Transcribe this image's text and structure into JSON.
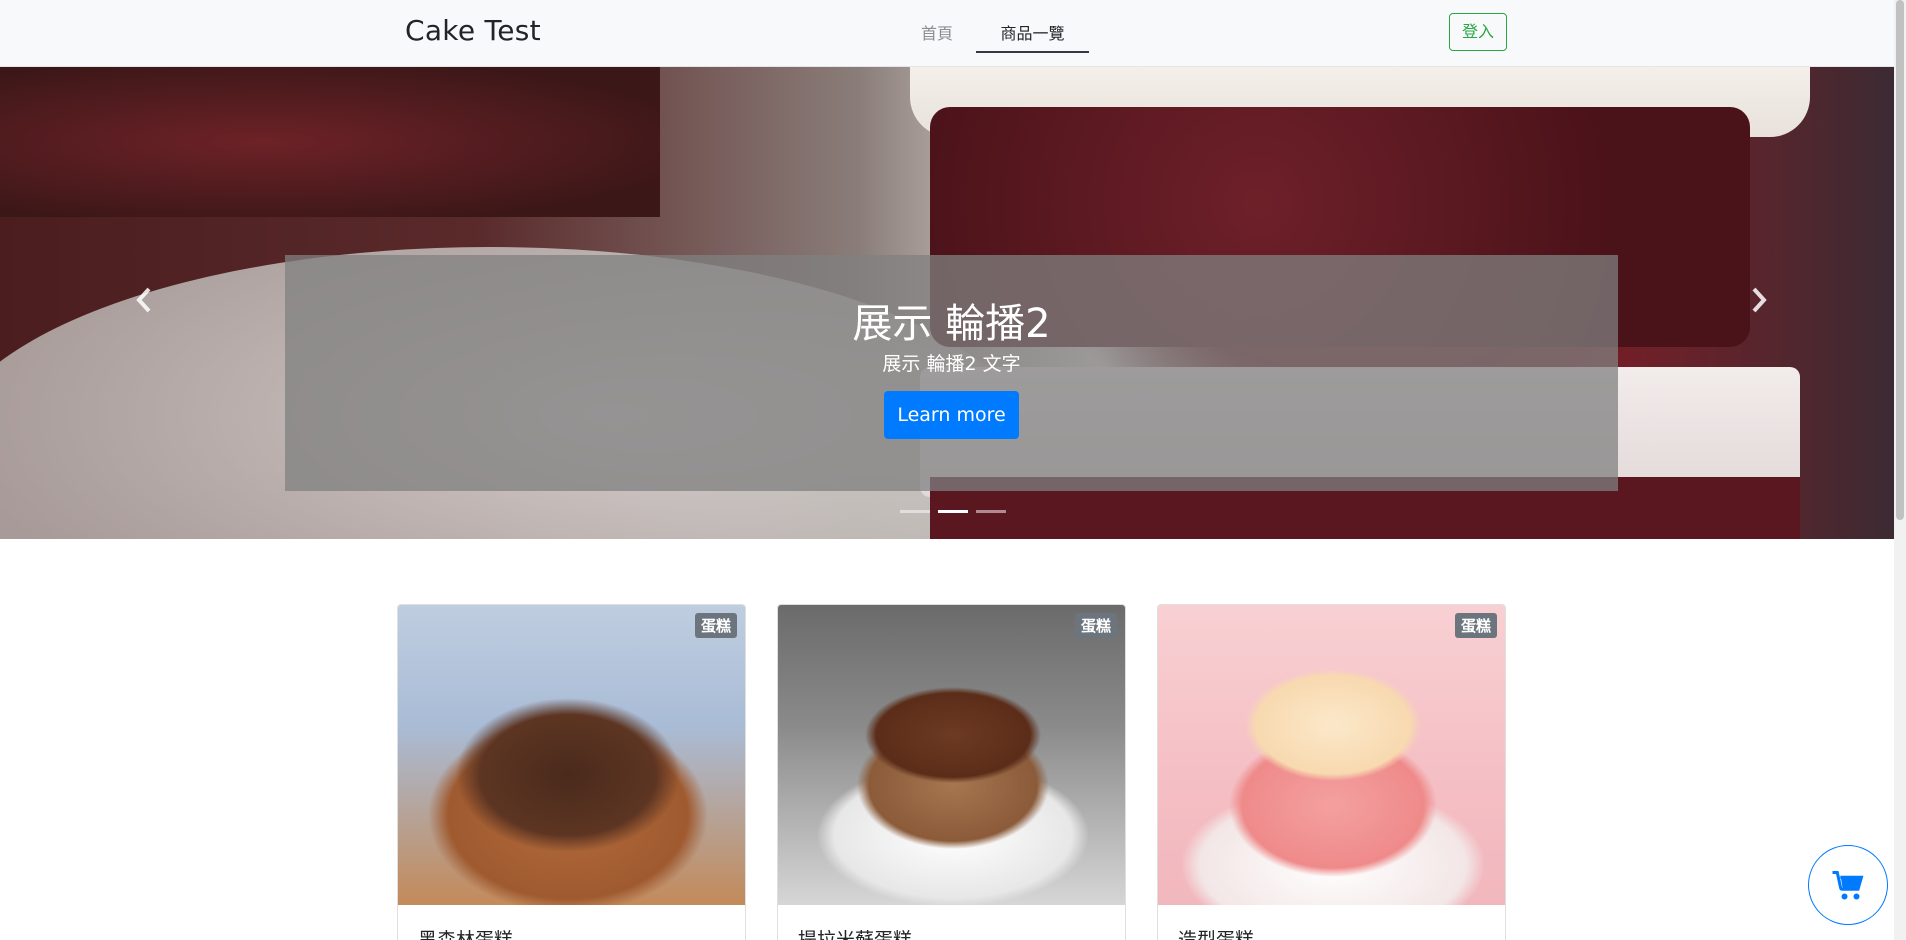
{
  "navbar": {
    "brand": "Cake Test",
    "links": [
      {
        "label": "首頁"
      },
      {
        "label": "商品一覽"
      }
    ],
    "login_label": "登入"
  },
  "carousel": {
    "title": "展示 輪播2",
    "text": "展示 輪播2 文字",
    "button_label": "Learn more",
    "prev_icon": "‹",
    "next_icon": "›",
    "indicators": 3,
    "active_index": 1
  },
  "products": [
    {
      "badge": "蛋糕",
      "title": "黑森林蛋糕"
    },
    {
      "badge": "蛋糕",
      "title": "提拉米蘇蛋糕"
    },
    {
      "badge": "蛋糕",
      "title": "造型蛋糕"
    }
  ],
  "colors": {
    "primary": "#007bff",
    "success": "#28a745",
    "badge": "#6c757d"
  },
  "icons": {
    "cart": "shopping-cart-icon"
  }
}
